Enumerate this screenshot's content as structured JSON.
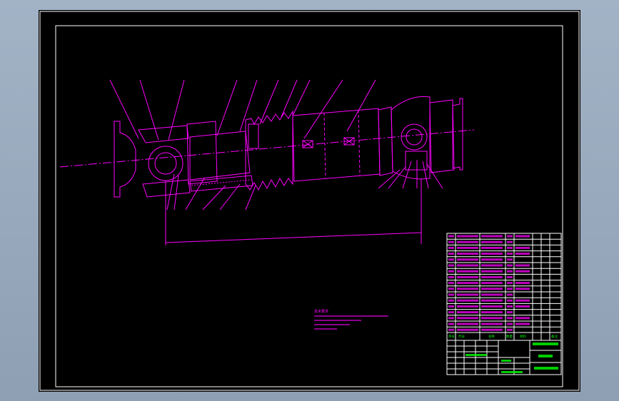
{
  "drawing": {
    "dimension_label": "...",
    "notes_title": "技术要求",
    "notes_lines": [
      "",
      "",
      "",
      ""
    ]
  },
  "title_block": {
    "col_seq": "序号",
    "col_code": "代号",
    "col_name": "名称",
    "col_qty": "数量",
    "col_material": "材料",
    "col_note": "备注",
    "school": "",
    "drawing_name": "",
    "drawing_code": "",
    "scale": ""
  },
  "colors": {
    "background": "#000000",
    "frame": "#ffffff",
    "geometry": "#ff00ff",
    "table_text": "#00ff00",
    "app_backdrop": "#9aa9bd"
  }
}
